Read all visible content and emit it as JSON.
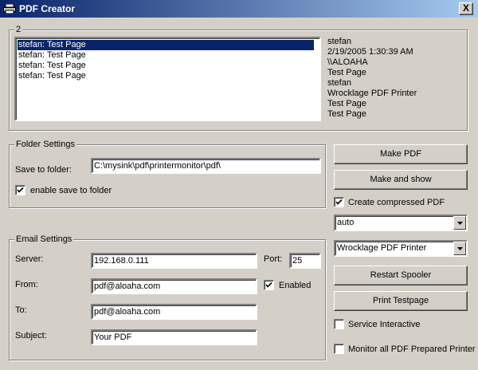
{
  "window": {
    "title": "PDF Creator",
    "close_glyph": "X"
  },
  "jobs_group": {
    "caption": "2",
    "items": [
      {
        "label": "stefan: Test Page",
        "selected": true
      },
      {
        "label": "stefan: Test Page",
        "selected": false
      },
      {
        "label": "stefan: Test Page",
        "selected": false
      },
      {
        "label": "stefan: Test Page",
        "selected": false
      }
    ],
    "details": [
      "stefan",
      "2/19/2005 1:30:39 AM",
      "\\\\ALOAHA",
      "Test Page",
      "stefan",
      "Wrocklage PDF Printer",
      "Test Page",
      "Test Page"
    ]
  },
  "folder_settings": {
    "legend": "Folder Settings",
    "save_label": "Save to folder:",
    "save_value": "C:\\mysink\\pdf\\printermonitor\\pdf\\",
    "enable_label": "enable save to folder",
    "enable_checked": true
  },
  "email_settings": {
    "legend": "Email Settings",
    "server_label": "Server:",
    "server_value": "192.168.0.111",
    "port_label": "Port:",
    "port_value": "25",
    "from_label": "From:",
    "from_value": "pdf@aloaha.com",
    "enabled_label": "Enabled",
    "enabled_checked": true,
    "to_label": "To:",
    "to_value": "pdf@aloaha.com",
    "subject_label": "Subject:",
    "subject_value": "Your PDF"
  },
  "actions": {
    "make_pdf": "Make PDF",
    "make_and_show": "Make and show",
    "compressed_label": "Create compressed PDF",
    "compressed_checked": true,
    "compression_value": "auto",
    "printer_value": "Wrocklage PDF Printer",
    "restart_spooler": "Restart Spooler",
    "print_testpage": "Print Testpage",
    "service_interactive_label": "Service Interactive",
    "service_interactive_checked": false,
    "monitor_all_label": "Monitor all PDF Prepared Printer",
    "monitor_all_checked": false
  },
  "icons": {
    "title_icon": "printer-icon",
    "check_glyph": "check-icon",
    "dropdown_glyph": "chevron-down-icon"
  }
}
